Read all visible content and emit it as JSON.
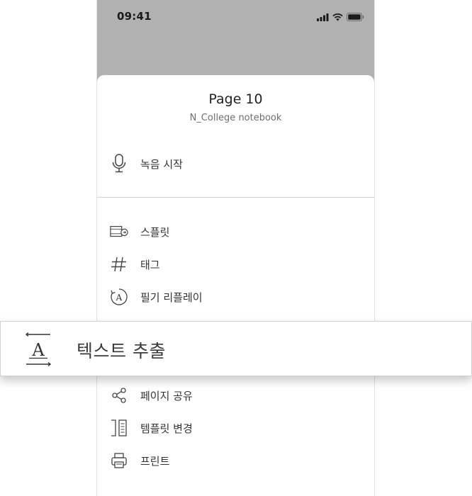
{
  "status_bar": {
    "time": "09:41",
    "icons": [
      "signal-icon",
      "wifi-icon",
      "battery-icon"
    ]
  },
  "sheet": {
    "title": "Page 10",
    "subtitle": "N_College notebook",
    "record": {
      "label": "녹음 시작",
      "icon": "microphone-icon"
    },
    "items": [
      {
        "label": "스플릿",
        "icon": "split-icon"
      },
      {
        "label": "태그",
        "icon": "hashtag-icon"
      },
      {
        "label": "필기 리플레이",
        "icon": "replay-icon"
      },
      {
        "label": "페이지 공유",
        "icon": "share-icon"
      },
      {
        "label": "템플릿 변경",
        "icon": "template-icon"
      },
      {
        "label": "프린트",
        "icon": "printer-icon"
      }
    ]
  },
  "highlighted_item": {
    "label": "텍스트 추출",
    "icon": "text-extract-icon"
  },
  "colors": {
    "status_bar_bg": "#b1b1b1",
    "text_primary": "#333333",
    "text_secondary": "#6e6e6e",
    "divider": "#d3d3d3"
  }
}
